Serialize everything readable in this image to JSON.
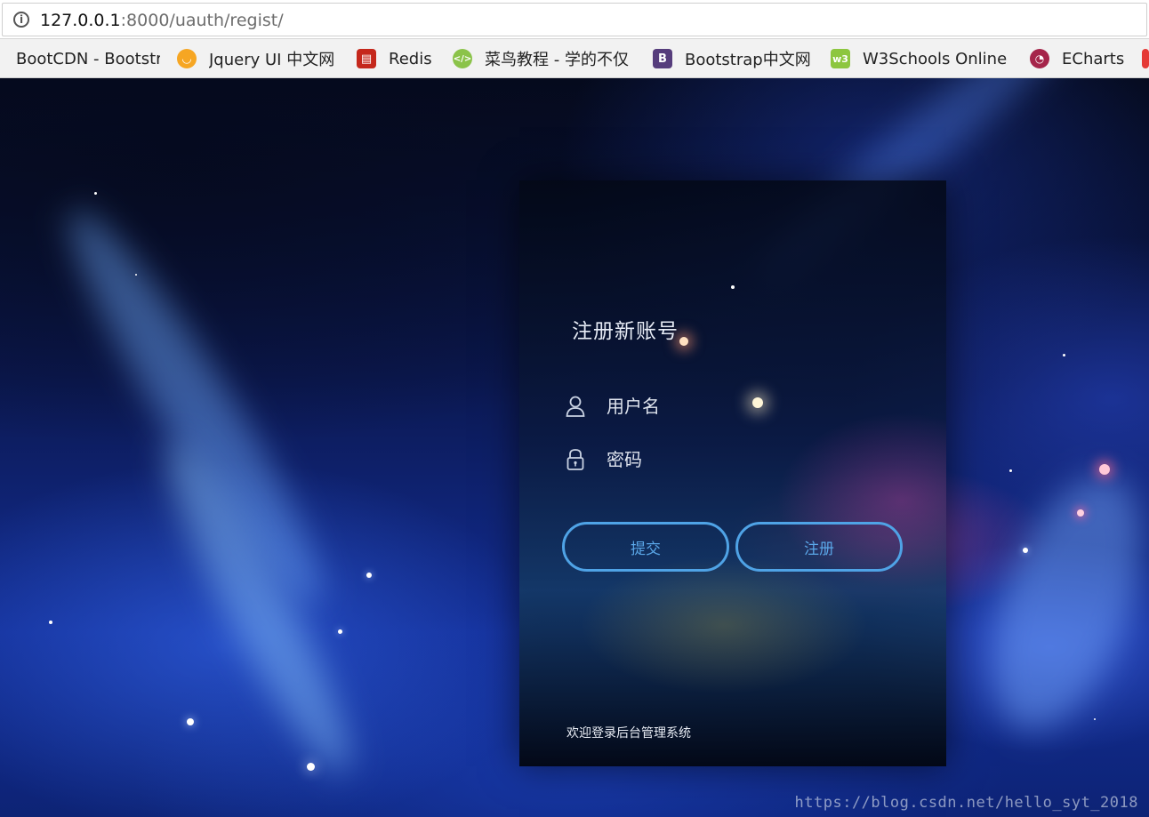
{
  "browser": {
    "url_host": "127.0.0.1",
    "url_rest": ":8000/uauth/regist/",
    "info_icon": "info-icon"
  },
  "bookmarks": [
    {
      "label": "BootCDN - Bootstr",
      "icon": "bootcdn-icon",
      "color": "#7a1ea8"
    },
    {
      "label": "Jquery UI 中文网",
      "icon": "jquery-ui-icon",
      "color": "#f6a623"
    },
    {
      "label": "Redis",
      "icon": "redis-icon",
      "color": "#c5281c"
    },
    {
      "label": "菜鸟教程 - 学的不仅",
      "icon": "runoob-icon",
      "color": "#8bc34a"
    },
    {
      "label": "Bootstrap中文网",
      "icon": "bootstrap-icon",
      "color": "#563d7c"
    },
    {
      "label": "W3Schools Online",
      "icon": "w3schools-icon",
      "color": "#8dc63f"
    },
    {
      "label": "ECharts",
      "icon": "echarts-icon",
      "color": "#a5244a"
    }
  ],
  "form": {
    "title": "注册新账号",
    "username_placeholder": "用户名",
    "password_placeholder": "密码",
    "submit_label": "提交",
    "register_label": "注册",
    "footer": "欢迎登录后台管理系统"
  },
  "watermark": "https://blog.csdn.net/hello_syt_2018"
}
